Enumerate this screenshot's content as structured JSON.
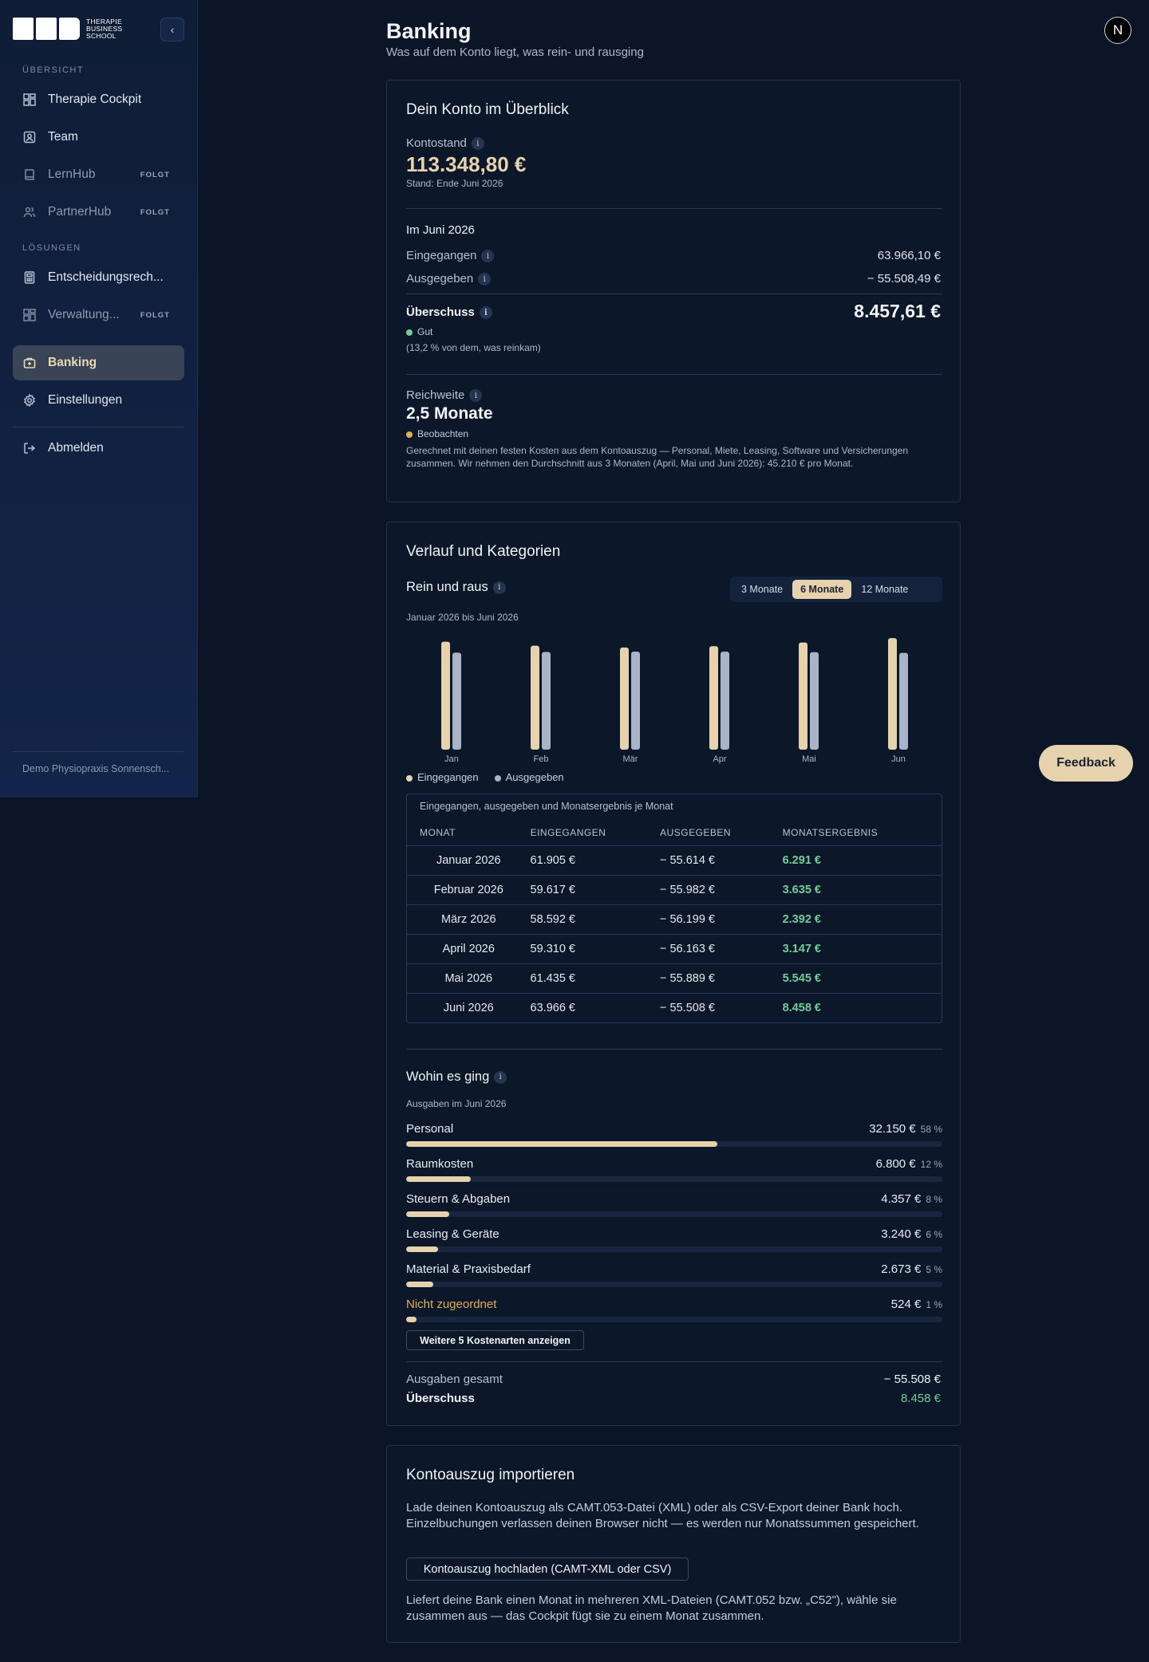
{
  "sidebar": {
    "logo_text": [
      "THERAPIE",
      "BUSINESS",
      "SCHOOL"
    ],
    "section_overview": "ÜBERSICHT",
    "section_solutions": "LÖSUNGEN",
    "items": [
      {
        "label": "Therapie Cockpit",
        "icon": "grid-icon"
      },
      {
        "label": "Team",
        "icon": "user-badge-icon"
      },
      {
        "label": "LernHub",
        "icon": "book-icon",
        "badge": "FOLGT"
      },
      {
        "label": "PartnerHub",
        "icon": "users-icon",
        "badge": "FOLGT"
      },
      {
        "label": "Entscheidungsrech...",
        "icon": "calculator-icon"
      },
      {
        "label": "Verwaltung...",
        "icon": "grid-icon",
        "badge": "FOLGT"
      },
      {
        "label": "Banking",
        "icon": "briefcase-icon"
      },
      {
        "label": "Einstellungen",
        "icon": "gear-icon"
      },
      {
        "label": "Abmelden",
        "icon": "logout-icon"
      }
    ],
    "footer": "Demo Physiopraxis Sonnensch..."
  },
  "header": {
    "title": "Banking",
    "subtitle": "Was auf dem Konto liegt, was rein- und rausging",
    "avatar_letter": "N"
  },
  "overview": {
    "title": "Dein Konto im Überblick",
    "balance_label": "Kontostand",
    "balance_value": "113.348,80 €",
    "balance_note": "Stand: Ende Juni 2026",
    "month_heading": "Im Juni 2026",
    "income_label": "Eingegangen",
    "income_value": "63.966,10 €",
    "spent_label": "Ausgegeben",
    "spent_value": "− 55.508,49 €",
    "surplus_label": "Überschuss",
    "surplus_value": "8.457,61 €",
    "surplus_status": "Gut",
    "surplus_note": "(13,2 % von dem, was reinkam)",
    "reach_label": "Reichweite",
    "reach_value": "2,5 Monate",
    "reach_status": "Beobachten",
    "reach_note": "Gerechnet mit deinen festen Kosten aus dem Kontoauszug — Personal, Miete, Leasing, Software und Versicherungen zusammen. Wir nehmen den Durchschnitt aus 3 Monaten (April, Mai und Juni 2026): 45.210 € pro Monat."
  },
  "history": {
    "title": "Verlauf und Kategorien",
    "chart_heading": "Rein und raus",
    "range_options": [
      "3 Monate",
      "6 Monate",
      "12 Monate"
    ],
    "range_selected": "6 Monate",
    "period": "Januar 2026 bis Juni 2026",
    "legend_in": "Eingegangen",
    "legend_out": "Ausgegeben",
    "table_caption": "Eingegangen, ausgegeben und Monatsergebnis je Monat",
    "table_headers": [
      "MONAT",
      "EINGEGANGEN",
      "AUSGEGEBEN",
      "MONATSERGEBNIS"
    ],
    "table_rows": [
      [
        "Januar 2026",
        "61.905 €",
        "− 55.614 €",
        "6.291 €"
      ],
      [
        "Februar 2026",
        "59.617 €",
        "− 55.982 €",
        "3.635 €"
      ],
      [
        "März 2026",
        "58.592 €",
        "− 56.199 €",
        "2.392 €"
      ],
      [
        "April 2026",
        "59.310 €",
        "− 56.163 €",
        "3.147 €"
      ],
      [
        "Mai 2026",
        "61.435 €",
        "− 55.889 €",
        "5.545 €"
      ],
      [
        "Juni 2026",
        "63.966 €",
        "− 55.508 €",
        "8.458 €"
      ]
    ]
  },
  "chart_data": {
    "type": "bar",
    "categories": [
      "Jan",
      "Feb",
      "Mär",
      "Apr",
      "Mai",
      "Jun"
    ],
    "series": [
      {
        "name": "Eingegangen",
        "values": [
          61905,
          59617,
          58592,
          59310,
          61435,
          63966
        ],
        "color": "#e6d2ad"
      },
      {
        "name": "Ausgegeben",
        "values": [
          55614,
          55982,
          56199,
          56163,
          55889,
          55508
        ],
        "color": "#aab4c8"
      }
    ],
    "ylim": [
      0,
      64000
    ],
    "grid": false,
    "legend": "bottom-left"
  },
  "categories": {
    "title": "Wohin es ging",
    "subtitle": "Ausgaben im Juni 2026",
    "items": [
      {
        "label": "Personal",
        "amount": "32.150 €",
        "pct": "58 %",
        "share": 0.58
      },
      {
        "label": "Raumkosten",
        "amount": "6.800 €",
        "pct": "12 %",
        "share": 0.12
      },
      {
        "label": "Steuern & Abgaben",
        "amount": "4.357 €",
        "pct": "8 %",
        "share": 0.08
      },
      {
        "label": "Leasing & Geräte",
        "amount": "3.240 €",
        "pct": "6 %",
        "share": 0.06
      },
      {
        "label": "Material & Praxisbedarf",
        "amount": "2.673 €",
        "pct": "5 %",
        "share": 0.05
      },
      {
        "label": "Nicht zugeordnet",
        "amount": "524 €",
        "pct": "1 %",
        "share": 0.02,
        "highlight": "#e1b15a"
      }
    ],
    "more_button": "Weitere 5 Kostenarten anzeigen",
    "total_label": "Ausgaben gesamt",
    "total_value": "− 55.508 €",
    "surplus_label": "Überschuss",
    "surplus_value": "8.458 €"
  },
  "import": {
    "title": "Kontoauszug importieren",
    "text": "Lade deinen Kontoauszug als CAMT.053-Datei (XML) oder als CSV-Export deiner Bank hoch. Einzelbuchungen verlassen deinen Browser nicht — es werden nur Monatssummen gespeichert.",
    "button": "Kontoauszug hochladen (CAMT-XML oder CSV)",
    "note": "Liefert deine Bank einen Monat in mehreren XML-Dateien (CAMT.052 bzw. „C52\"), wähle sie zusammen aus — das Cockpit fügt sie zu einem Monat zusammen."
  },
  "feedback_label": "Feedback",
  "colors": {
    "accent": "#e6d2ad",
    "positive": "#6fcf97",
    "warning": "#e1b15a",
    "background": "#0b1527"
  }
}
